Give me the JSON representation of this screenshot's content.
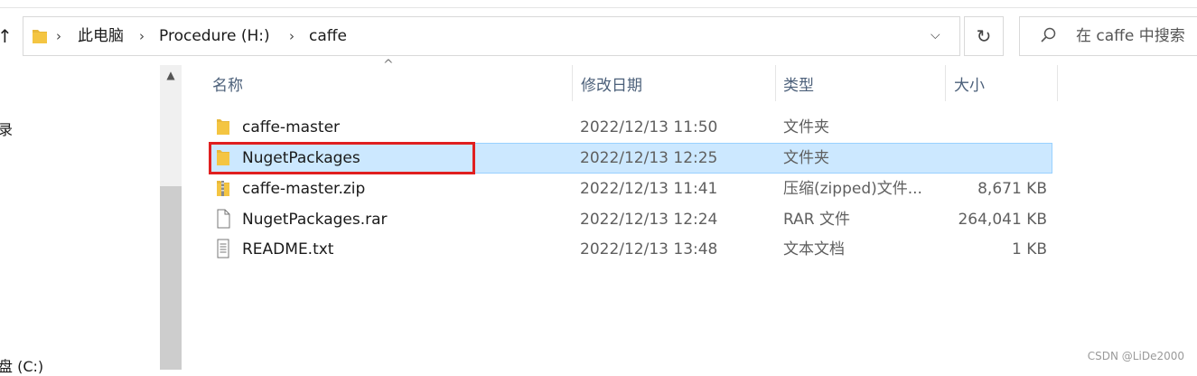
{
  "address": {
    "crumbs": [
      "此电脑",
      "Procedure (H:)",
      "caffe"
    ]
  },
  "search": {
    "placeholder": "在 caffe 中搜索"
  },
  "nav": {
    "frag_top": "录",
    "frag_bottom": "盘 (C:)"
  },
  "columns": {
    "name": "名称",
    "date": "修改日期",
    "type": "类型",
    "size": "大小"
  },
  "files": [
    {
      "name": "caffe-master",
      "date": "2022/12/13 11:50",
      "type": "文件夹",
      "size": "",
      "icon": "folder-icon"
    },
    {
      "name": "NugetPackages",
      "date": "2022/12/13 12:25",
      "type": "文件夹",
      "size": "",
      "icon": "folder-icon",
      "selected": true
    },
    {
      "name": "caffe-master.zip",
      "date": "2022/12/13 11:41",
      "type": "压缩(zipped)文件...",
      "size": "8,671 KB",
      "icon": "zip-folder-icon"
    },
    {
      "name": "NugetPackages.rar",
      "date": "2022/12/13 12:24",
      "type": "RAR 文件",
      "size": "264,041 KB",
      "icon": "file-icon"
    },
    {
      "name": "README.txt",
      "date": "2022/12/13 13:48",
      "type": "文本文档",
      "size": "1 KB",
      "icon": "text-file-icon"
    }
  ],
  "watermark": "CSDN @LiDe2000",
  "colors": {
    "selection": "#cce8ff",
    "highlight_box": "#e02020",
    "folder": "#f4c542"
  }
}
